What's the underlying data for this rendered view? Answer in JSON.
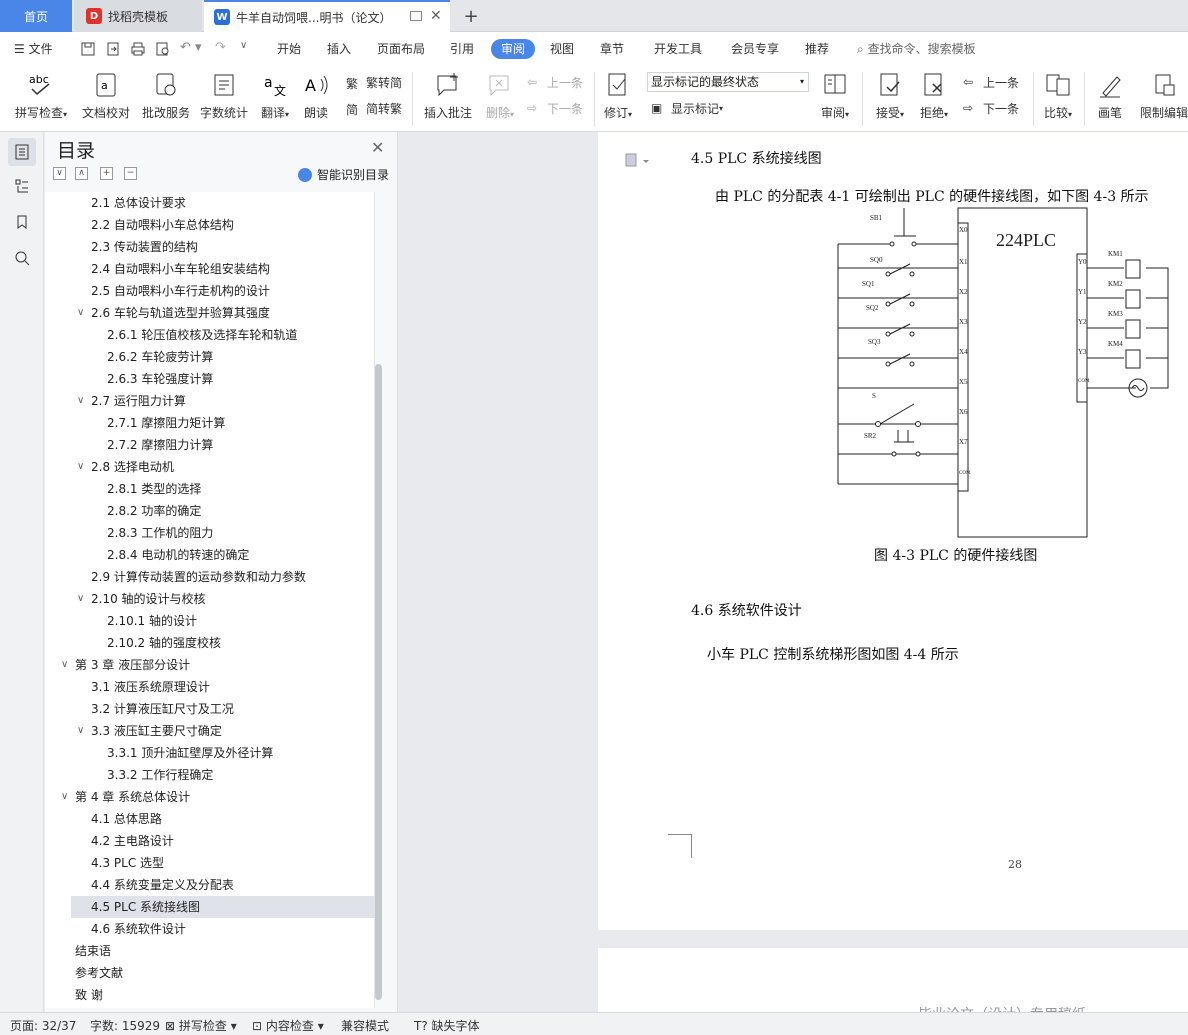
{
  "tabs": {
    "home": "首页",
    "template": "找稻壳模板",
    "doc": "牛羊自动饲喂...明书（论文）",
    "add": "+"
  },
  "menu": [
    "文件",
    "开始",
    "插入",
    "页面布局",
    "引用",
    "审阅",
    "视图",
    "章节",
    "开发工具",
    "会员专享",
    "推荐"
  ],
  "search_placeholder": "查找命令、搜索模板",
  "ribbon": {
    "spell": "拼写检查",
    "proof": "文档校对",
    "batch": "批改服务",
    "count": "字数统计",
    "translate": "翻译",
    "read": "朗读",
    "t2s": "繁转简",
    "s2t": "简转繁",
    "insert_comment": "插入批注",
    "delete": "删除",
    "prev1": "上一条",
    "next1": "下一条",
    "revise": "修订",
    "show_state": "显示标记的最终状态",
    "show_marks": "显示标记",
    "review": "审阅",
    "accept": "接受",
    "reject": "拒绝",
    "prev2": "上一条",
    "next2": "下一条",
    "compare": "比较",
    "pen": "画笔",
    "restrict": "限制编辑"
  },
  "toc": {
    "title": "目录",
    "smart": "智能识别目录",
    "items": [
      {
        "text": "2.1  总体设计要求",
        "level": 2
      },
      {
        "text": "2.2  自动喂料小车总体结构",
        "level": 2
      },
      {
        "text": "2.3  传动装置的结构",
        "level": 2
      },
      {
        "text": "2.4  自动喂料小车车轮组安装结构",
        "level": 2
      },
      {
        "text": "2.5 自动喂料小车行走机构的设计",
        "level": 2
      },
      {
        "text": "2.6 车轮与轨道选型并验算其强度",
        "level": 2,
        "toggle": "∨"
      },
      {
        "text": "2.6.1 轮压值校核及选择车轮和轨道",
        "level": 3
      },
      {
        "text": "2.6.2 车轮疲劳计算",
        "level": 3
      },
      {
        "text": "2.6.3 车轮强度计算",
        "level": 3
      },
      {
        "text": "2.7    运行阻力计算",
        "level": 2,
        "toggle": "∨"
      },
      {
        "text": "2.7.1 摩擦阻力矩计算",
        "level": 3
      },
      {
        "text": "2.7.2 摩擦阻力计算",
        "level": 3
      },
      {
        "text": "2.8  选择电动机",
        "level": 2,
        "toggle": "∨"
      },
      {
        "text": "2.8.1 类型的选择",
        "level": 3
      },
      {
        "text": "2.8.2 功率的确定",
        "level": 3
      },
      {
        "text": "2.8.3 工作机的阻力",
        "level": 3
      },
      {
        "text": "2.8.4 电动机的转速的确定",
        "level": 3
      },
      {
        "text": "2.9 计算传动装置的运动参数和动力参数",
        "level": 2
      },
      {
        "text": "2.10 轴的设计与校核",
        "level": 2,
        "toggle": "∨"
      },
      {
        "text": "2.10.1 轴的设计",
        "level": 3
      },
      {
        "text": "2.10.2  轴的强度校核",
        "level": 3
      },
      {
        "text": "第 3 章  液压部分设计",
        "level": 1,
        "toggle": "∨"
      },
      {
        "text": "3.1  液压系统原理设计",
        "level": 2
      },
      {
        "text": "3.2 计算液压缸尺寸及工况",
        "level": 2
      },
      {
        "text": "3.3 液压缸主要尺寸确定",
        "level": 2,
        "toggle": "∨"
      },
      {
        "text": "3.3.1 顶升油缸壁厚及外径计算",
        "level": 3
      },
      {
        "text": "3.3.2 工作行程确定",
        "level": 3
      },
      {
        "text": "第 4 章  系统总体设计",
        "level": 1,
        "toggle": "∨"
      },
      {
        "text": "4.1  总体思路",
        "level": 2
      },
      {
        "text": "4.2  主电路设计",
        "level": 2
      },
      {
        "text": "4.3 PLC 选型",
        "level": 2
      },
      {
        "text": "4.4  系统变量定义及分配表",
        "level": 2
      },
      {
        "text": "4.5 PLC 系统接线图",
        "level": 2,
        "selected": true
      },
      {
        "text": "4.6 系统软件设计",
        "level": 2
      },
      {
        "text": "结束语",
        "level": 1
      },
      {
        "text": "参考文献",
        "level": 1
      },
      {
        "text": "致     谢",
        "level": 1
      }
    ]
  },
  "doc": {
    "heading_45": "4.5 PLC 系统接线图",
    "para_45": "由 PLC 的分配表 4-1 可绘制出 PLC 的硬件接线图，如下图 4-3 所示",
    "figure": {
      "plc_model": "224PLC",
      "input_switches": [
        "SB1",
        "SQ0",
        "SQ1",
        "SQ2",
        "SQ3",
        "S",
        "SR2"
      ],
      "input_terminals": [
        "X0",
        "X1",
        "X2",
        "X3",
        "X4",
        "X5",
        "X6",
        "X7",
        "COM"
      ],
      "output_terminals": [
        "Y0",
        "Y1",
        "Y2",
        "Y3",
        "COM"
      ],
      "coils": [
        "KM1",
        "KM2",
        "KM3",
        "KM4"
      ]
    },
    "caption": "图 4-3  PLC 的硬件接线图",
    "heading_46": "4.6 系统软件设计",
    "para_46": "小车 PLC 控制系统梯形图如图 4-4 所示",
    "page_number": "28",
    "next_page_text": "毕业论文（设计）专用稿纸"
  },
  "status": {
    "page": "页面: 32/37",
    "words": "字数: 15929",
    "spell": "拼写检查",
    "content": "内容检查",
    "compat": "兼容模式",
    "missing_font": "缺失字体"
  },
  "colors": {
    "accent": "#4a86e8",
    "wps_red": "#e0312d"
  }
}
